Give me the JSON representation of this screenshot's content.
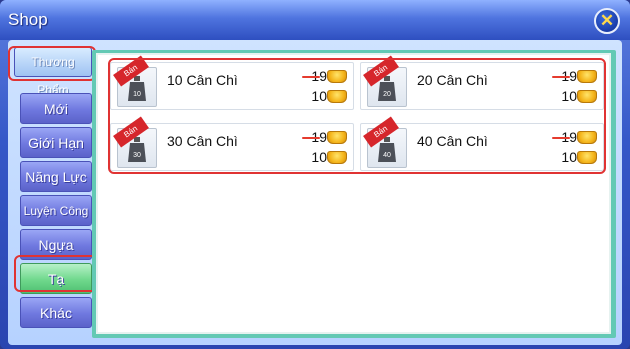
{
  "window": {
    "title": "Shop",
    "close_glyph": "✕"
  },
  "tabs": [
    {
      "label": "Thương Phẩm",
      "active": false
    },
    {
      "label": "Mới",
      "active": false
    },
    {
      "label": "Giới Hạn",
      "active": false
    },
    {
      "label": "Năng Lực",
      "active": false
    },
    {
      "label": "Luyện Công",
      "active": false
    },
    {
      "label": "Ngựa",
      "active": false
    },
    {
      "label": "Tạ",
      "active": true
    },
    {
      "label": "Khác",
      "active": false
    }
  ],
  "items": [
    {
      "name": "10 Cân Chì",
      "badge": "Bán",
      "weight_label": "10",
      "old_price": "19",
      "new_price": "10"
    },
    {
      "name": "20 Cân Chì",
      "badge": "Bán",
      "weight_label": "20",
      "old_price": "19",
      "new_price": "10"
    },
    {
      "name": "30 Cân Chì",
      "badge": "Bán",
      "weight_label": "30",
      "old_price": "19",
      "new_price": "10"
    },
    {
      "name": "40 Cân Chì",
      "badge": "Bán",
      "weight_label": "40",
      "old_price": "19",
      "new_price": "10"
    }
  ],
  "colors": {
    "highlight": "#e03333",
    "active_tab": "#6fd88c",
    "tab": "#6f78df",
    "panel_border": "#63c9b4"
  },
  "icons": {
    "close": "close-icon",
    "currency": "gold-ingot-icon",
    "item": "iron-weight-icon"
  }
}
